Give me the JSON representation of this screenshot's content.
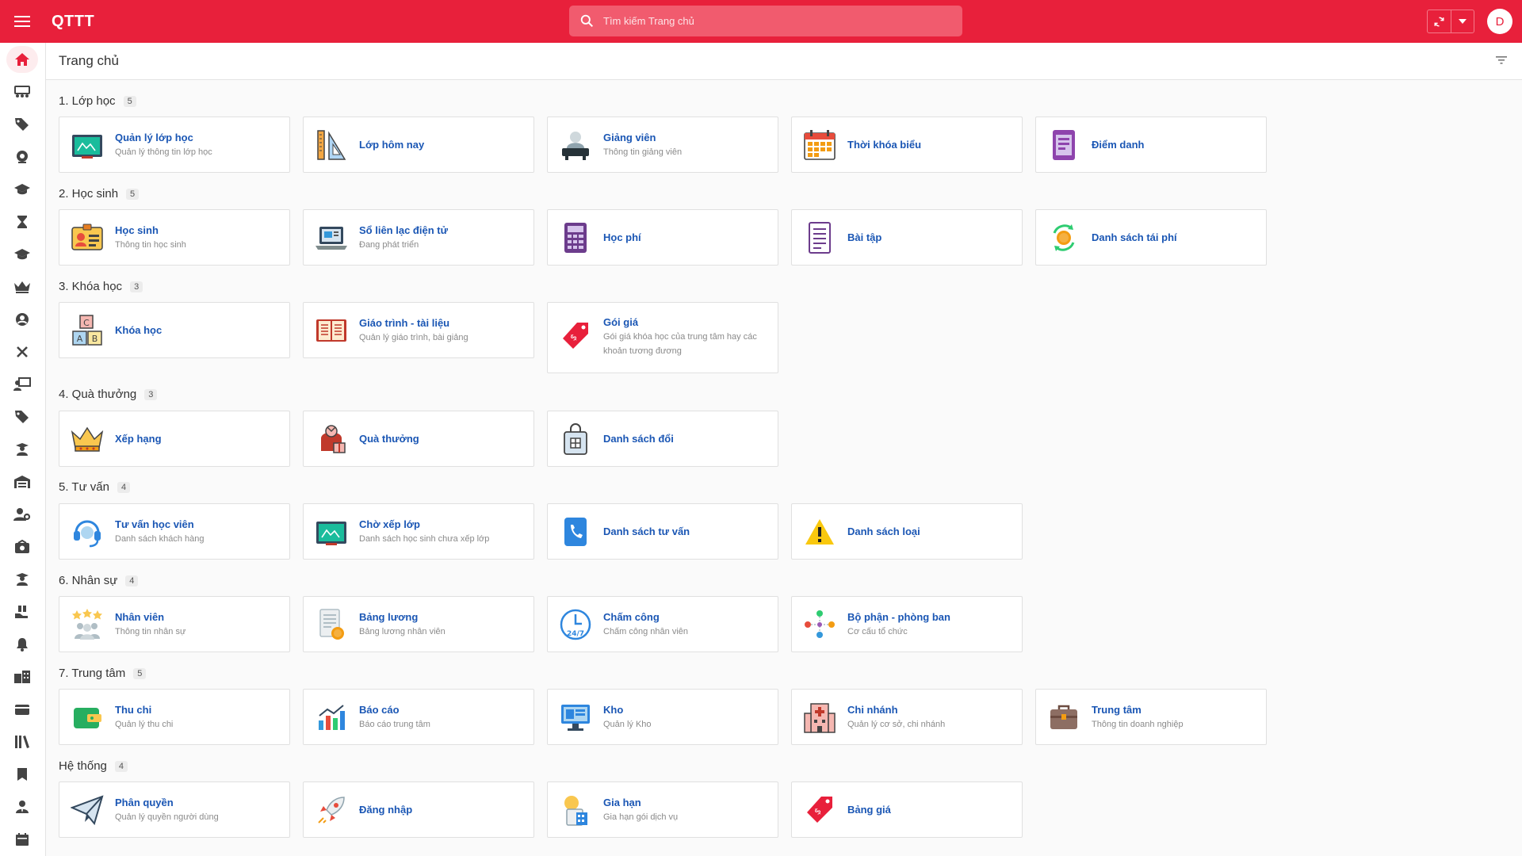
{
  "app": {
    "title": "QTTT",
    "avatar_initial": "D"
  },
  "search": {
    "placeholder": "Tìm kiếm Trang chủ"
  },
  "header": {
    "title": "Trang chủ"
  },
  "colors": {
    "accent": "#e8203b",
    "link": "#1a56b4"
  },
  "sidebar": {
    "items": [
      {
        "icon": "home-icon"
      },
      {
        "icon": "classroom-icon"
      },
      {
        "icon": "tag-icon"
      },
      {
        "icon": "webcam-icon"
      },
      {
        "icon": "graduation-cap-icon"
      },
      {
        "icon": "hourglass-icon"
      },
      {
        "icon": "graduation-cap-icon"
      },
      {
        "icon": "crown-icon"
      },
      {
        "icon": "user-circle-icon"
      },
      {
        "icon": "close-icon"
      },
      {
        "icon": "teacher-board-icon"
      },
      {
        "icon": "tags-icon"
      },
      {
        "icon": "teacher-icon"
      },
      {
        "icon": "warehouse-icon"
      },
      {
        "icon": "user-cog-icon"
      },
      {
        "icon": "money-icon"
      },
      {
        "icon": "student-icon"
      },
      {
        "icon": "gift-hand-icon"
      },
      {
        "icon": "bell-icon"
      },
      {
        "icon": "building-icon"
      },
      {
        "icon": "wallet-icon"
      },
      {
        "icon": "library-icon"
      },
      {
        "icon": "bookmark-icon"
      },
      {
        "icon": "user-tie-icon"
      },
      {
        "icon": "calendar-icon"
      }
    ]
  },
  "sections": [
    {
      "title": "1. Lớp học",
      "count": "5",
      "cards": [
        {
          "title": "Quản lý lớp học",
          "subtitle": "Quản lý thông tin lớp học",
          "icon": "chalkboard-icon"
        },
        {
          "title": "Lớp hôm nay",
          "subtitle": "",
          "icon": "ruler-pencil-icon"
        },
        {
          "title": "Giảng viên",
          "subtitle": "Thông tin giảng viên",
          "icon": "teacher-desk-icon"
        },
        {
          "title": "Thời khóa biểu",
          "subtitle": "",
          "icon": "calendar-grid-icon"
        },
        {
          "title": "Điểm danh",
          "subtitle": "",
          "icon": "attendance-icon"
        }
      ]
    },
    {
      "title": "2. Học sinh",
      "count": "5",
      "cards": [
        {
          "title": "Học sinh",
          "subtitle": "Thông tin học sinh",
          "icon": "id-card-icon"
        },
        {
          "title": "Sổ liên lạc điện tử",
          "subtitle": "Đang phát triển",
          "icon": "laptop-icon"
        },
        {
          "title": "Học phí",
          "subtitle": "",
          "icon": "calculator-icon"
        },
        {
          "title": "Bài tập",
          "subtitle": "",
          "icon": "document-icon"
        },
        {
          "title": "Danh sách tái phí",
          "subtitle": "",
          "icon": "coin-cycle-icon"
        }
      ]
    },
    {
      "title": "3. Khóa học",
      "count": "3",
      "cards": [
        {
          "title": "Khóa học",
          "subtitle": "",
          "icon": "abc-blocks-icon"
        },
        {
          "title": "Giáo trình - tài liệu",
          "subtitle": "Quản lý giáo trình, bài giảng",
          "icon": "open-book-icon"
        },
        {
          "title": "Gói giá",
          "subtitle": "Gói giá khóa học của trung tâm hay các khoản tương đương",
          "icon": "price-tag-icon"
        }
      ]
    },
    {
      "title": "4. Quà thưởng",
      "count": "3",
      "cards": [
        {
          "title": "Xếp hạng",
          "subtitle": "",
          "icon": "crown-icon"
        },
        {
          "title": "Quà thưởng",
          "subtitle": "",
          "icon": "gift-bag-icon"
        },
        {
          "title": "Danh sách đổi",
          "subtitle": "",
          "icon": "shopping-bag-icon"
        }
      ]
    },
    {
      "title": "5. Tư vấn",
      "count": "4",
      "cards": [
        {
          "title": "Tư vấn học viên",
          "subtitle": "Danh sách khách hàng",
          "icon": "headset-icon"
        },
        {
          "title": "Chờ xếp lớp",
          "subtitle": "Danh sách học sinh chưa xếp lớp",
          "icon": "chalkboard-icon"
        },
        {
          "title": "Danh sách tư vấn",
          "subtitle": "",
          "icon": "phone-icon"
        },
        {
          "title": "Danh sách loại",
          "subtitle": "",
          "icon": "warning-icon"
        }
      ]
    },
    {
      "title": "6. Nhân sự",
      "count": "4",
      "cards": [
        {
          "title": "Nhân viên",
          "subtitle": "Thông tin nhân sự",
          "icon": "staff-stars-icon"
        },
        {
          "title": "Bảng lương",
          "subtitle": "Bảng lương nhân viên",
          "icon": "payroll-icon"
        },
        {
          "title": "Chấm công",
          "subtitle": "Chấm công nhân viên",
          "icon": "clock-247-icon"
        },
        {
          "title": "Bộ phận - phòng ban",
          "subtitle": "Cơ cấu tổ chức",
          "icon": "org-chart-icon"
        }
      ]
    },
    {
      "title": "7. Trung tâm",
      "count": "5",
      "cards": [
        {
          "title": "Thu chi",
          "subtitle": "Quản lý thu chi",
          "icon": "wallet-icon"
        },
        {
          "title": "Báo cáo",
          "subtitle": "Báo cáo trung tâm",
          "icon": "bar-chart-icon"
        },
        {
          "title": "Kho",
          "subtitle": "Quản lý Kho",
          "icon": "monitor-icon"
        },
        {
          "title": "Chi nhánh",
          "subtitle": "Quản lý cơ sở, chi nhánh",
          "icon": "hospital-building-icon"
        },
        {
          "title": "Trung tâm",
          "subtitle": "Thông tin doanh nghiệp",
          "icon": "briefcase-icon"
        }
      ]
    },
    {
      "title": "Hệ thống",
      "count": "4",
      "cards": [
        {
          "title": "Phân quyền",
          "subtitle": "Quản lý quyền người dùng",
          "icon": "paper-plane-icon"
        },
        {
          "title": "Đăng nhập",
          "subtitle": "",
          "icon": "rocket-icon"
        },
        {
          "title": "Gia hạn",
          "subtitle": "Gia hạn gói dịch vụ",
          "icon": "renew-icon"
        },
        {
          "title": "Bảng giá",
          "subtitle": "",
          "icon": "price-tag-icon"
        }
      ]
    }
  ]
}
